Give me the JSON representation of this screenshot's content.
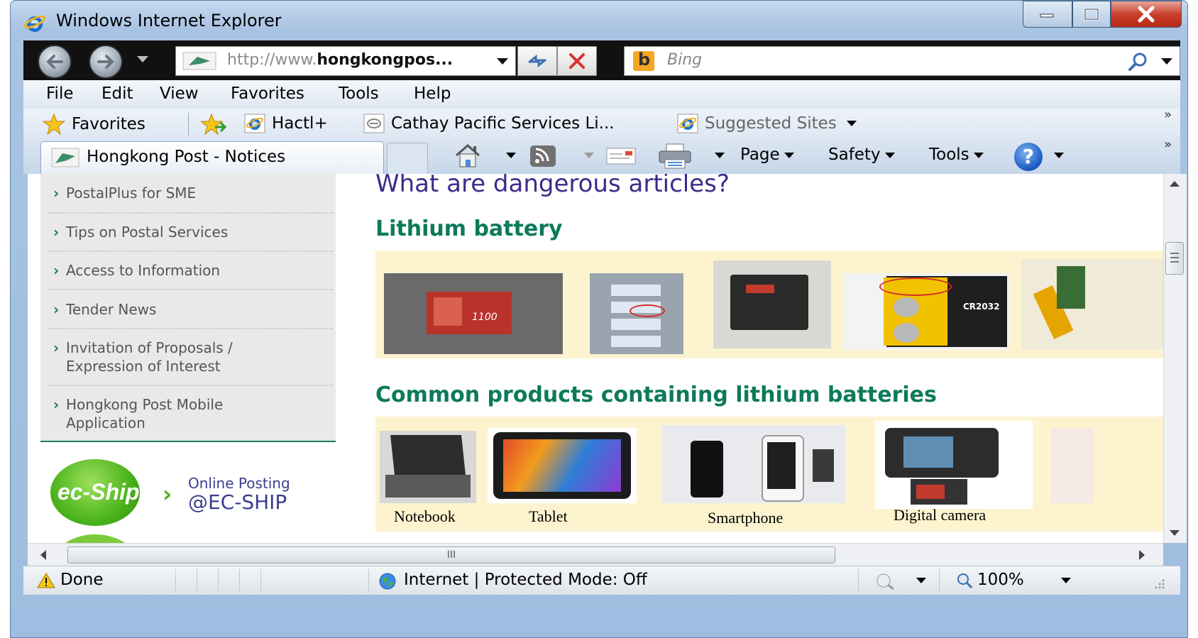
{
  "window": {
    "title": "Windows Internet Explorer"
  },
  "navigation": {
    "address_prefix": "http://www.",
    "address_domain": "hongkongpos...",
    "search_placeholder": "Bing"
  },
  "menu": [
    "File",
    "Edit",
    "View",
    "Favorites",
    "Tools",
    "Help"
  ],
  "favorites_bar": {
    "favorites_label": "Favorites",
    "links": [
      "Hactl+",
      "Cathay Pacific Services Li...",
      "Suggested Sites"
    ]
  },
  "tab": {
    "title": "Hongkong Post - Notices"
  },
  "command_bar": {
    "page": "Page",
    "safety": "Safety",
    "tools": "Tools"
  },
  "sidebar": {
    "items": [
      "PostalPlus for SME",
      "Tips on Postal Services",
      "Access to Information",
      "Tender News",
      "Invitation of Proposals / Expression of Interest",
      "Hongkong Post Mobile Application"
    ],
    "ecship": {
      "logo_text": "ec-Ship",
      "line1": "Online Posting",
      "line2": "@EC-SHIP"
    }
  },
  "main": {
    "heading": "What are dangerous articles?",
    "section1": "Lithium battery",
    "section2": "Common products containing lithium batteries",
    "products": [
      "Notebook",
      "Tablet",
      "Smartphone",
      "Digital camera"
    ],
    "battery_photo_text": "1100",
    "coin_cell_text": "CR2032"
  },
  "hscroll_grip": "III",
  "status": {
    "left": "Done",
    "zone": "Internet | Protected Mode: Off",
    "zoom": "100%"
  }
}
